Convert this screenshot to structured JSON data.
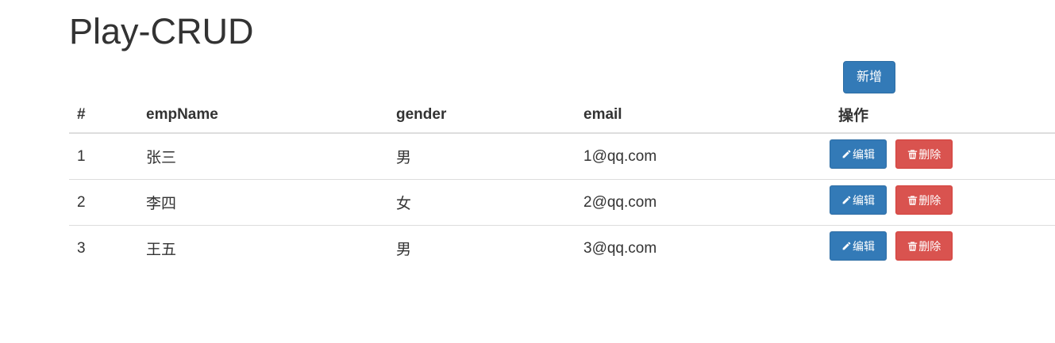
{
  "page": {
    "title": "Play-CRUD"
  },
  "toolbar": {
    "add_label": "新增"
  },
  "table": {
    "headers": {
      "id": "#",
      "emp_name": "empName",
      "gender": "gender",
      "email": "email",
      "actions": "操作"
    },
    "rows": [
      {
        "id": "1",
        "emp_name": "张三",
        "gender": "男",
        "email": "1@qq.com"
      },
      {
        "id": "2",
        "emp_name": "李四",
        "gender": "女",
        "email": "2@qq.com"
      },
      {
        "id": "3",
        "emp_name": "王五",
        "gender": "男",
        "email": "3@qq.com"
      }
    ],
    "edit_label": "编辑",
    "delete_label": "删除",
    "edit_icon": "pencil-icon",
    "delete_icon": "trash-icon"
  },
  "colors": {
    "primary": "#337ab7",
    "danger": "#d9534f",
    "text": "#333333",
    "border": "#dddddd"
  }
}
